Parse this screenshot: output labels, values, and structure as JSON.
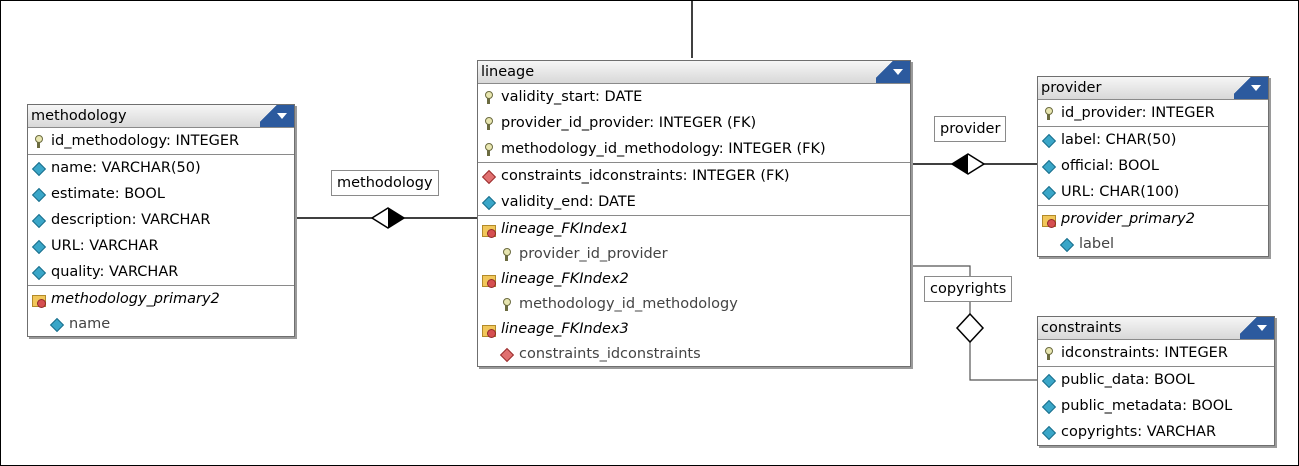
{
  "entities": {
    "methodology": {
      "title": "methodology",
      "columns": [
        {
          "name": "id_methodology: INTEGER",
          "icon": "key-icon"
        },
        {
          "name": "name: VARCHAR(50)",
          "icon": "attribute-icon"
        },
        {
          "name": "estimate: BOOL",
          "icon": "attribute-icon"
        },
        {
          "name": "description: VARCHAR",
          "icon": "attribute-icon"
        },
        {
          "name": "URL: VARCHAR",
          "icon": "attribute-icon"
        },
        {
          "name": "quality: VARCHAR",
          "icon": "attribute-icon"
        }
      ],
      "indexes": [
        {
          "name": "methodology_primary2",
          "fields": [
            "name"
          ]
        }
      ]
    },
    "lineage": {
      "title": "lineage",
      "keys": [
        "validity_start: DATE",
        "provider_id_provider: INTEGER (FK)",
        "methodology_id_methodology: INTEGER (FK)"
      ],
      "columns": [
        {
          "name": "constraints_idconstraints: INTEGER (FK)",
          "icon": "foreign-attribute-icon"
        },
        {
          "name": "validity_end: DATE",
          "icon": "attribute-icon"
        }
      ],
      "indexes": [
        {
          "name": "lineage_FKIndex1",
          "field": "provider_id_provider"
        },
        {
          "name": "lineage_FKIndex2",
          "field": "methodology_id_methodology"
        },
        {
          "name": "lineage_FKIndex3",
          "field": "constraints_idconstraints"
        }
      ]
    },
    "provider": {
      "title": "provider",
      "columns": [
        {
          "name": "id_provider: INTEGER",
          "icon": "key-icon"
        },
        {
          "name": "label: CHAR(50)",
          "icon": "attribute-icon"
        },
        {
          "name": "official: BOOL",
          "icon": "attribute-icon"
        },
        {
          "name": "URL: CHAR(100)",
          "icon": "attribute-icon"
        }
      ],
      "indexes": [
        {
          "name": "provider_primary2",
          "fields": [
            "label"
          ]
        }
      ]
    },
    "constraints": {
      "title": "constraints",
      "columns": [
        {
          "name": "idconstraints: INTEGER",
          "icon": "key-icon"
        },
        {
          "name": "public_data: BOOL",
          "icon": "attribute-icon"
        },
        {
          "name": "public_metadata: BOOL",
          "icon": "attribute-icon"
        },
        {
          "name": "copyrights: VARCHAR",
          "icon": "attribute-icon"
        }
      ]
    }
  },
  "relations": {
    "methodology": "methodology",
    "provider": "provider",
    "copyrights": "copyrights"
  }
}
